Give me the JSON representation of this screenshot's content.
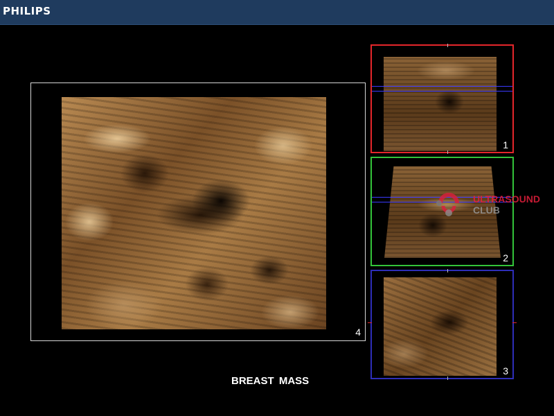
{
  "header": {
    "brand": "PHILIPS",
    "background_color": "#1f3b5e"
  },
  "main_view": {
    "number": "4"
  },
  "side_views": [
    {
      "number": "1",
      "frame_color": "#e5262b"
    },
    {
      "number": "2",
      "frame_color": "#33c43a"
    },
    {
      "number": "3",
      "frame_color": "#2e2eb8"
    }
  ],
  "watermark": {
    "line1": "ULTRASOUND",
    "line2": "CLUB",
    "icon": "logo-mark"
  },
  "caption": "BREAST  MASS"
}
